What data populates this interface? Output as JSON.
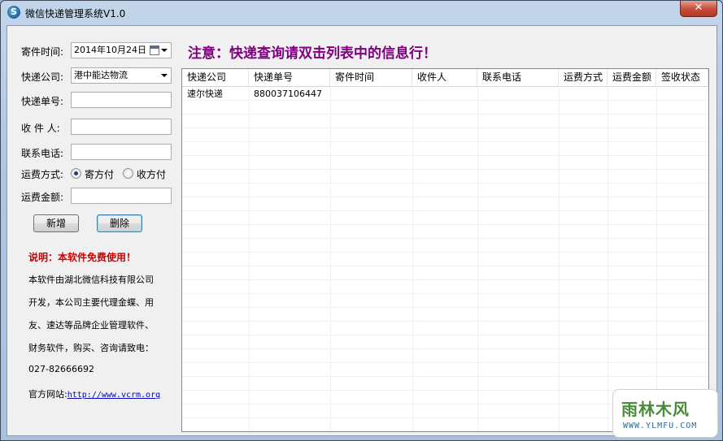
{
  "window": {
    "title": "微信快递管理系统V1.0",
    "app_icon": "S",
    "close_glyph": "✕"
  },
  "form": {
    "send_time_label": "寄件时间:",
    "send_time_value": "2014年10月24日",
    "company_label": "快递公司:",
    "company_value": "港中能达物流",
    "tracking_label": "快递单号:",
    "tracking_value": "",
    "recipient_label": "收 件 人:",
    "recipient_value": "",
    "phone_label": "联系电话:",
    "phone_value": "",
    "payment_label": "运费方式:",
    "payment_options": [
      "寄方付",
      "收方付"
    ],
    "payment_selected": "寄方付",
    "amount_label": "运费金额:",
    "amount_value": "",
    "add_button": "新增",
    "delete_button": "删除"
  },
  "info": {
    "heading": "说明：本软件免费使用！",
    "lines": [
      "本软件由湖北微信科技有限公司",
      "开发，本公司主要代理金蝶、用",
      "友、速达等品牌企业管理软件、",
      "财务软件，购买、咨询请致电：",
      "027-82666692"
    ],
    "site_label": "官方网站:",
    "site_url": "http://www.vcrm.org"
  },
  "notice": "注意：快递查询请双击列表中的信息行！",
  "table": {
    "columns": [
      "快递公司",
      "快递单号",
      "寄件时间",
      "收件人",
      "联系电话",
      "运费方式",
      "运费金额",
      "签收状态"
    ],
    "rows": [
      [
        "速尔快递",
        "880037106447",
        "",
        "",
        "",
        "",
        "",
        ""
      ]
    ]
  },
  "watermark": {
    "main": "雨林木风",
    "sub": "WWW.YLMFU.COM"
  }
}
